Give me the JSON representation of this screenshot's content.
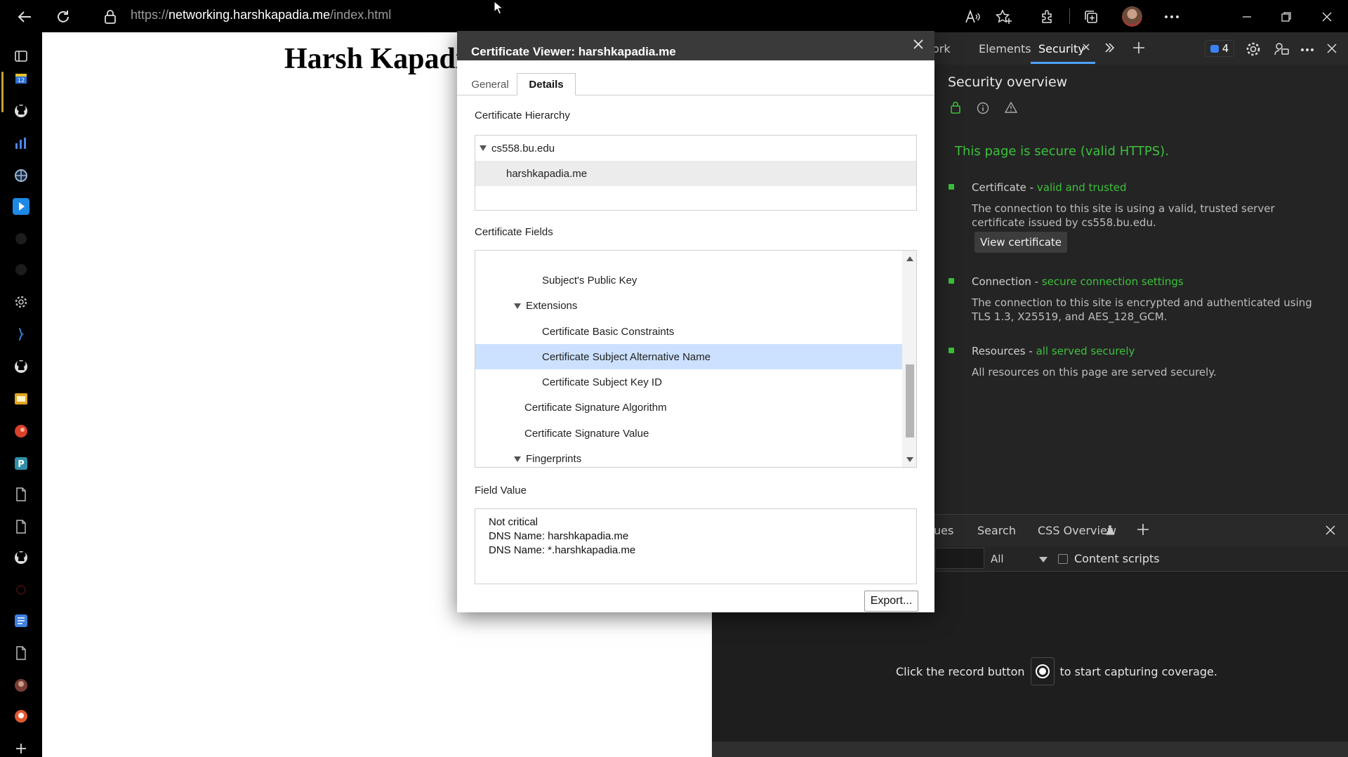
{
  "browser": {
    "url_prefix": "https://",
    "url_host": "networking.harshkapadia.me",
    "url_path": "/index.html"
  },
  "page": {
    "heading": "Harsh Kapadi"
  },
  "devtools": {
    "tabs": {
      "network_partial": "ork",
      "elements": "Elements",
      "security": "Security"
    },
    "messages_count": "4",
    "security": {
      "title": "Security overview",
      "status": "This page is secure (valid HTTPS).",
      "certificate_label": "Certificate - ",
      "certificate_status": "valid and trusted",
      "certificate_desc": "The connection to this site is using a valid, trusted server certificate issued by cs558.bu.edu.",
      "view_certificate": "View certificate",
      "connection_label": "Connection - ",
      "connection_status": "secure connection settings",
      "connection_desc": "The connection to this site is encrypted and authenticated using TLS 1.3, X25519, and AES_128_GCM.",
      "resources_label": "Resources - ",
      "resources_status": "all served securely",
      "resources_desc": "All resources on this page are served securely."
    },
    "drawer": {
      "tabs": {
        "issues_partial": "ues",
        "search": "Search",
        "css_overview": "CSS Overview"
      },
      "filter_select": "All",
      "content_scripts": "Content scripts",
      "coverage_before": "Click the record button",
      "coverage_after": "to start capturing coverage."
    }
  },
  "cert_dialog": {
    "title": "Certificate Viewer: harshkapadia.me",
    "tabs": {
      "general": "General",
      "details": "Details"
    },
    "hierarchy_label": "Certificate Hierarchy",
    "hierarchy": [
      "cs558.bu.edu",
      "harshkapadia.me"
    ],
    "fields_label": "Certificate Fields",
    "fields": [
      {
        "label": "Subject's Public Key",
        "selected": false
      },
      {
        "label": "Extensions",
        "selected": false
      },
      {
        "label": "Certificate Basic Constraints",
        "selected": false
      },
      {
        "label": "Certificate Subject Alternative Name",
        "selected": true
      },
      {
        "label": "Certificate Subject Key ID",
        "selected": false
      },
      {
        "label": "Certificate Signature Algorithm",
        "selected": false
      },
      {
        "label": "Certificate Signature Value",
        "selected": false
      },
      {
        "label": "Fingerprints",
        "selected": false
      }
    ],
    "value_label": "Field Value",
    "value_lines": [
      "Not critical",
      "DNS Name: harshkapadia.me",
      "DNS Name: *.harshkapadia.me"
    ],
    "export": "Export..."
  },
  "colors": {
    "secure_green": "#3cc13c",
    "security_tab_underline": "#4ea1ff",
    "selected_row": "#cce1ff"
  }
}
